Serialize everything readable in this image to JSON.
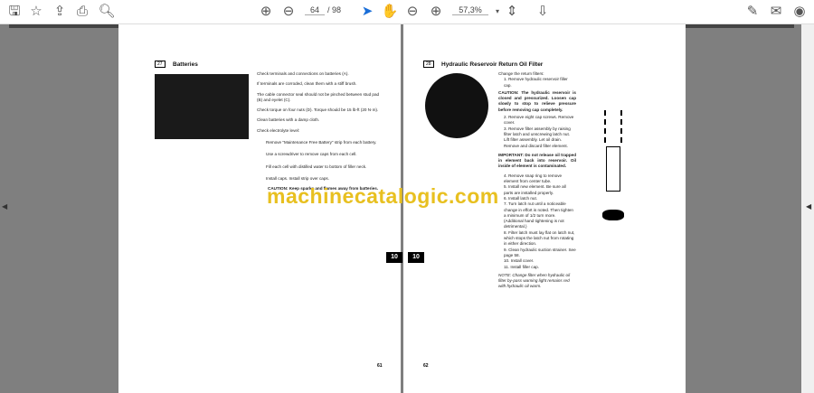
{
  "toolbar": {
    "page_current": "64",
    "page_total": "/ 98",
    "zoom": "57,3%"
  },
  "left_page": {
    "section_num": "27",
    "title": "Batteries",
    "paragraphs": [
      "Check terminals and connections on batteries (A).",
      "If terminals are corroded, clean them with a stiff brush.",
      "The cable connector seal should not be pinched between stud pad (B) and eyelet (C).",
      "Check torque on four nuts (D). Torque should be 15 lb-ft (20 N·m).",
      "Clean batteries with a damp cloth.",
      "Check electrolyte level:"
    ],
    "bullets": [
      "Remove \"Maintenance Free Battery\" strip from each battery.",
      "Use a screwdriver to remove caps from each cell.",
      "Fill each cell with distilled water to bottom of filler neck.",
      "Install caps. Install strip over caps."
    ],
    "caution": "CAUTION: Keep sparks and flames away from batteries.",
    "tab": "10",
    "page_number": "61"
  },
  "right_page": {
    "section_num": "28",
    "title": "Hydraulic Reservoir Return Oil Filter",
    "intro": "Change the return filters:",
    "step1": "1. Remove hydraulic reservoir filler cap.",
    "caution": "CAUTION: The hydraulic reservoir is closed and pressurized. Loosen cap slowly to stop to relieve pressure before removing cap completely.",
    "steps_a": [
      "2. Remove eight cap screws. Remove cover.",
      "3. Remove filter assembly by raising filter latch and unscrewing latch nut. Lift filter assembly. Let oil drain. Remove and discard filter element."
    ],
    "important": "IMPORTANT: Do not release oil trapped in element back into reservoir. Oil inside of element is contaminated.",
    "steps_b": [
      "4. Remove snap ring to remove element from center tube.",
      "5. Install new element. Be sure all parts are installed properly.",
      "6. Install latch nut.",
      "7. Turn latch nut until a noticeable change in effort is noted. Then tighten a minimum of 1/2 turn more. (Additional hand tightening is not detrimental.)",
      "8. Filter latch must lay flat on latch nut, which stops the latch nut from rotating in either direction.",
      "9. Clean hydraulic suction strainer. See page 58.",
      "10. Install cover.",
      "11. Install filler cap."
    ],
    "note": "NOTE: Change filter when hydraulic oil filter by-pass warning light remains red with hydraulic oil warm.",
    "tab": "10",
    "page_number": "62"
  },
  "watermark": "machinecatalogic.com"
}
